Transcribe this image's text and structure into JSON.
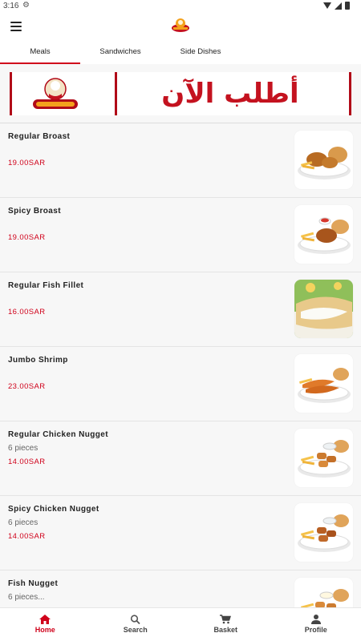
{
  "status_bar": {
    "time": "3:16",
    "settings_icon": "gear-icon"
  },
  "header": {
    "menu_icon": "hamburger-icon",
    "logo": "broast-logo"
  },
  "tabs": [
    {
      "label": "Meals",
      "active": true
    },
    {
      "label": "Sandwiches",
      "active": false
    },
    {
      "label": "Side Dishes",
      "active": false
    }
  ],
  "banner": {
    "logo_text": "Golden Broast",
    "headline": "أطلب الآن"
  },
  "menu_items": [
    {
      "name": "Regular Broast",
      "description": "",
      "price": "19.00SAR"
    },
    {
      "name": "Spicy Broast",
      "description": "",
      "price": "19.00SAR"
    },
    {
      "name": "Regular Fish Fillet",
      "description": "",
      "price": "16.00SAR"
    },
    {
      "name": "Jumbo Shrimp",
      "description": "",
      "price": "23.00SAR"
    },
    {
      "name": "Regular Chicken Nugget",
      "description": "6 pieces",
      "price": "14.00SAR"
    },
    {
      "name": "Spicy Chicken Nugget",
      "description": "6 pieces",
      "price": "14.00SAR"
    },
    {
      "name": "Fish Nugget",
      "description": "6 pieces...",
      "price": ""
    }
  ],
  "bottom_nav": [
    {
      "label": "Home",
      "icon": "home-icon",
      "active": true
    },
    {
      "label": "Search",
      "icon": "search-icon",
      "active": false
    },
    {
      "label": "Basket",
      "icon": "basket-icon",
      "active": false
    },
    {
      "label": "Profile",
      "icon": "profile-icon",
      "active": false
    }
  ],
  "colors": {
    "accent": "#d0021b",
    "banner_red": "#c4121f",
    "background": "#f7f7f7"
  }
}
